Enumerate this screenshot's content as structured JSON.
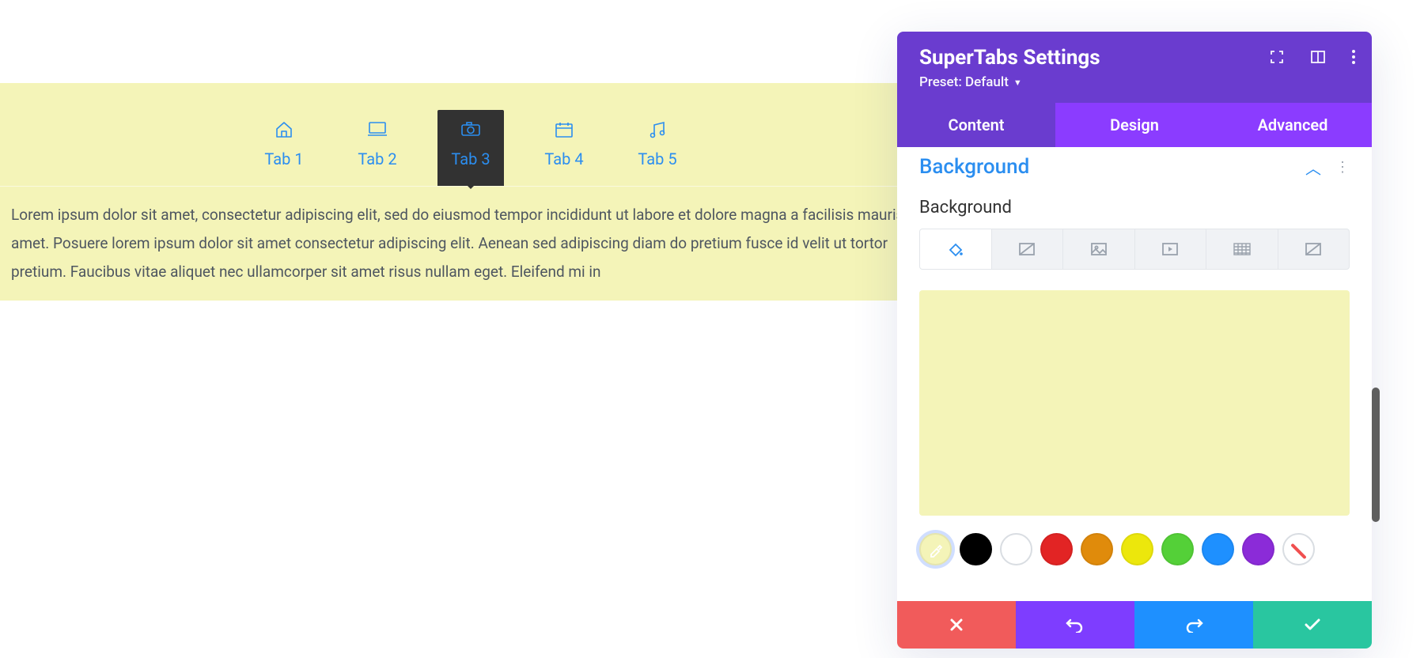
{
  "preview": {
    "active_tab_index": 2,
    "tabs": [
      {
        "icon": "home-icon",
        "label": "Tab 1"
      },
      {
        "icon": "laptop-icon",
        "label": "Tab 2"
      },
      {
        "icon": "camera-icon",
        "label": "Tab 3"
      },
      {
        "icon": "calendar-icon",
        "label": "Tab 4"
      },
      {
        "icon": "music-icon",
        "label": "Tab 5"
      }
    ],
    "content": "Lorem ipsum dolor sit amet, consectetur adipiscing elit, sed do eiusmod tempor incididunt ut labore et dolore magna a facilisis mauris sit amet. Posuere lorem ipsum dolor sit amet consectetur adipiscing elit. Aenean sed adipiscing diam do pretium fusce id velit ut tortor pretium. Faucibus vitae aliquet nec ullamcorper sit amet risus nullam eget. Eleifend mi in",
    "background_color": "#f4f4b8"
  },
  "panel": {
    "title": "SuperTabs Settings",
    "preset_label": "Preset: Default",
    "main_tabs": [
      "Content",
      "Design",
      "Advanced"
    ],
    "active_main_tab": 0,
    "section_title": "Background",
    "field_label": "Background",
    "bg_tab_icons": [
      "paint-bucket-icon",
      "gradient-icon",
      "image-icon",
      "video-icon",
      "pattern-icon",
      "mask-icon"
    ],
    "active_bg_tab": 0,
    "preview_color": "#f4f4b8",
    "swatches": [
      {
        "type": "picker",
        "color": "#f4f4b8"
      },
      {
        "type": "color",
        "color": "#000000"
      },
      {
        "type": "white",
        "color": "#ffffff"
      },
      {
        "type": "color",
        "color": "#e22424"
      },
      {
        "type": "color",
        "color": "#e08b0b"
      },
      {
        "type": "color",
        "color": "#ece70c"
      },
      {
        "type": "color",
        "color": "#54d038"
      },
      {
        "type": "color",
        "color": "#1e90ff"
      },
      {
        "type": "color",
        "color": "#8b2bd8"
      },
      {
        "type": "none",
        "color": "transparent"
      }
    ],
    "footer_icons": [
      "close-icon",
      "undo-icon",
      "redo-icon",
      "check-icon"
    ]
  }
}
